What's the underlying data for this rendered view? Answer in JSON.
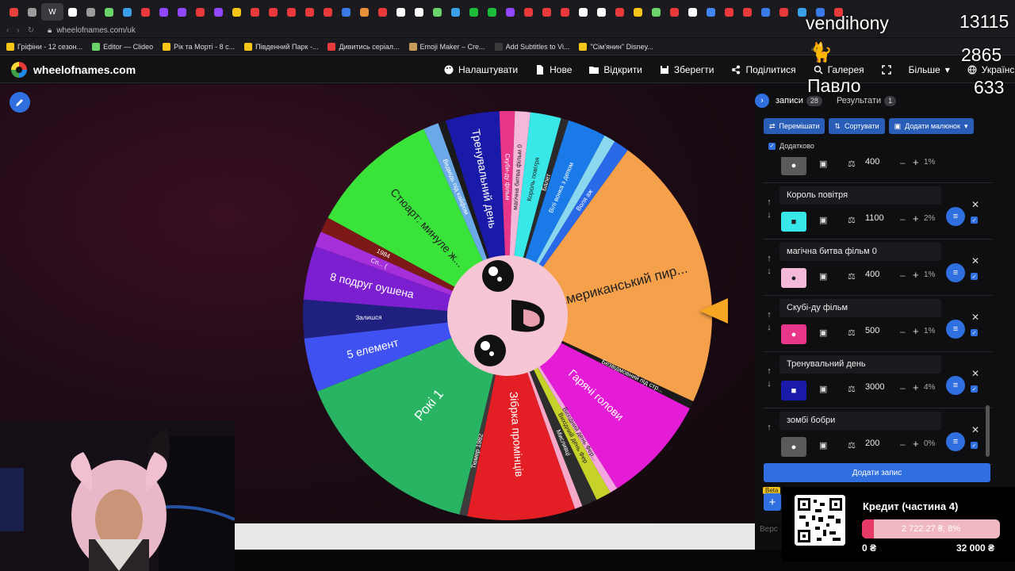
{
  "browser": {
    "active_tab_label": "W",
    "tab_colors": [
      "#e8403a",
      "#9b9b9b",
      "#e83a3a",
      "#ffffff",
      "#9b9b9b",
      "#6ad36a",
      "#3aa0e8",
      "#e83a3a",
      "#9146ff",
      "#9146ff",
      "#e83a3a",
      "#9146ff",
      "#f5c518",
      "#e83a3a",
      "#e83a3a",
      "#e83a3a",
      "#e83a3a",
      "#e83a3a",
      "#3a7ae8",
      "#e8903a",
      "#e83a3a",
      "#ffffff",
      "#ffffff",
      "#6ad36a",
      "#3aa0e8",
      "#1abc3a",
      "#1abc3a",
      "#9146ff",
      "#e83a3a",
      "#e83a3a",
      "#e83a3a",
      "#ffffff",
      "#ffffff",
      "#e83a3a",
      "#f5c518",
      "#6ad36a",
      "#e83a3a",
      "#ffffff",
      "#4285f4",
      "#e83a3a",
      "#e83a3a",
      "#3a7ae8",
      "#e83a3a",
      "#3aa0e8",
      "#3a7ae8",
      "#e83a3a"
    ],
    "url": "wheelofnames.com/uk",
    "bookmarks": [
      {
        "label": "Гріфіни - 12 сезон...",
        "color": "#f5c518"
      },
      {
        "label": "Editor — Clideo",
        "color": "#6ad36a"
      },
      {
        "label": "Рік та Морті - 8 с...",
        "color": "#f5c518"
      },
      {
        "label": "Південний Парк -...",
        "color": "#f5c518"
      },
      {
        "label": "Дивитись серіал...",
        "color": "#e83a3a"
      },
      {
        "label": "Emoji Maker – Cre...",
        "color": "#c89b5a"
      },
      {
        "label": "Add Subtitles to Vi...",
        "color": "#3a3a3a"
      },
      {
        "label": "\"Сім'янин\" Disney...",
        "color": "#f5c518"
      }
    ]
  },
  "header": {
    "site": "wheelofnames.com",
    "menu": {
      "customize": "Налаштувати",
      "new": "Нове",
      "open": "Відкрити",
      "save": "Зберегти",
      "share": "Поділитися",
      "gallery": "Галерея",
      "more": "Більше",
      "language": "Українська"
    }
  },
  "wheel": {
    "center_face": "cute-face",
    "slices": [
      {
        "label": "Американський пир...",
        "color": "#f5a04a"
      },
      {
        "label": "Безвідмовний під стр...",
        "color": "#1a1a1a"
      },
      {
        "label": "Гарячі голови",
        "color": "#e51cd6"
      },
      {
        "label": "Вихідний день Фер...",
        "color": "#f4a6e0"
      },
      {
        "label": "Вихідний день Фер",
        "color": "#c6d22a"
      },
      {
        "label": "Мисливці",
        "color": "#2d2d2d"
      },
      {
        "label": "",
        "color": "#f5a8c8"
      },
      {
        "label": "Зібрка промінців",
        "color": "#e31e24"
      },
      {
        "label": "Тюмер 1982",
        "color": "#3b3b3b"
      },
      {
        "label": "Рокі 1",
        "color": "#28b463"
      },
      {
        "label": "5 елемент",
        "color": "#3f51f0"
      },
      {
        "label": "Залишся",
        "color": "#1f2080"
      },
      {
        "label": "8 подруг оушена",
        "color": "#7b1fd0"
      },
      {
        "label": "Сп... (",
        "color": "#a52fd8"
      },
      {
        "label": "1984",
        "color": "#7d1818"
      },
      {
        "label": "Стюарт: минуле ж...",
        "color": "#3ae33a"
      },
      {
        "label": "Ведмідь під кайфом",
        "color": "#6aa8e8"
      },
      {
        "label": "",
        "color": "#1a1a1a"
      },
      {
        "label": "Тренувальний день",
        "color": "#1a1aa8"
      },
      {
        "label": "Скуби-ду фільм",
        "color": "#e8368a"
      },
      {
        "label": "магічна битва фільм 0",
        "color": "#f4b8d8"
      },
      {
        "label": "Король повітря",
        "color": "#38e8e8"
      },
      {
        "label": "Балет",
        "color": "#2a2a2a"
      },
      {
        "label": "Вілі вонка з депом",
        "color": "#1a7ae8"
      },
      {
        "label": "",
        "color": "#8ad8f0"
      },
      {
        "label": "Воля аж",
        "color": "#2a6ae8"
      }
    ]
  },
  "panel": {
    "entries_tab": "записи",
    "entries_count": "28",
    "results_tab": "Результати",
    "results_count": "1",
    "shuffle": "Перемішати",
    "sort": "Сортувати",
    "add_image": "Додати малюнок",
    "advanced": "Додатково",
    "entries": [
      {
        "name": "Король повітря",
        "color": "#38e8e8",
        "icon": "paint-roller-icon",
        "weight": "1100",
        "percent": "2%"
      },
      {
        "name": "магічна битва фільм 0",
        "color": "#f4b8d8",
        "icon": "palette-icon",
        "weight": "400",
        "percent": "1%"
      },
      {
        "name": "Скубі-ду фільм",
        "color": "#e8368a",
        "icon": "palette-icon",
        "weight": "500",
        "percent": "1%"
      },
      {
        "name": "Тренувальний день",
        "color": "#1a1aa8",
        "icon": "paint-roller-icon",
        "weight": "3000",
        "percent": "4%"
      },
      {
        "name": "зомбі бобри",
        "color": "#5a5a5a",
        "icon": "palette-icon",
        "weight": "200",
        "percent": "0%"
      }
    ],
    "partial_entry": {
      "weight": "400",
      "percent": "1%"
    },
    "add_entry": "Додати запис",
    "beta": "Beta",
    "version": "Верс"
  },
  "stream": {
    "channel": "vendihony",
    "stat1": "13115",
    "stat2": "2865",
    "user": "Павло",
    "stat3": "633",
    "cat": "🐈"
  },
  "donation": {
    "title": "Кредит (частина 4)",
    "progress_fraction": 0.085,
    "value": "2 722.27 ₴, 8%",
    "min": "0 ₴",
    "max": "32 000 ₴"
  }
}
